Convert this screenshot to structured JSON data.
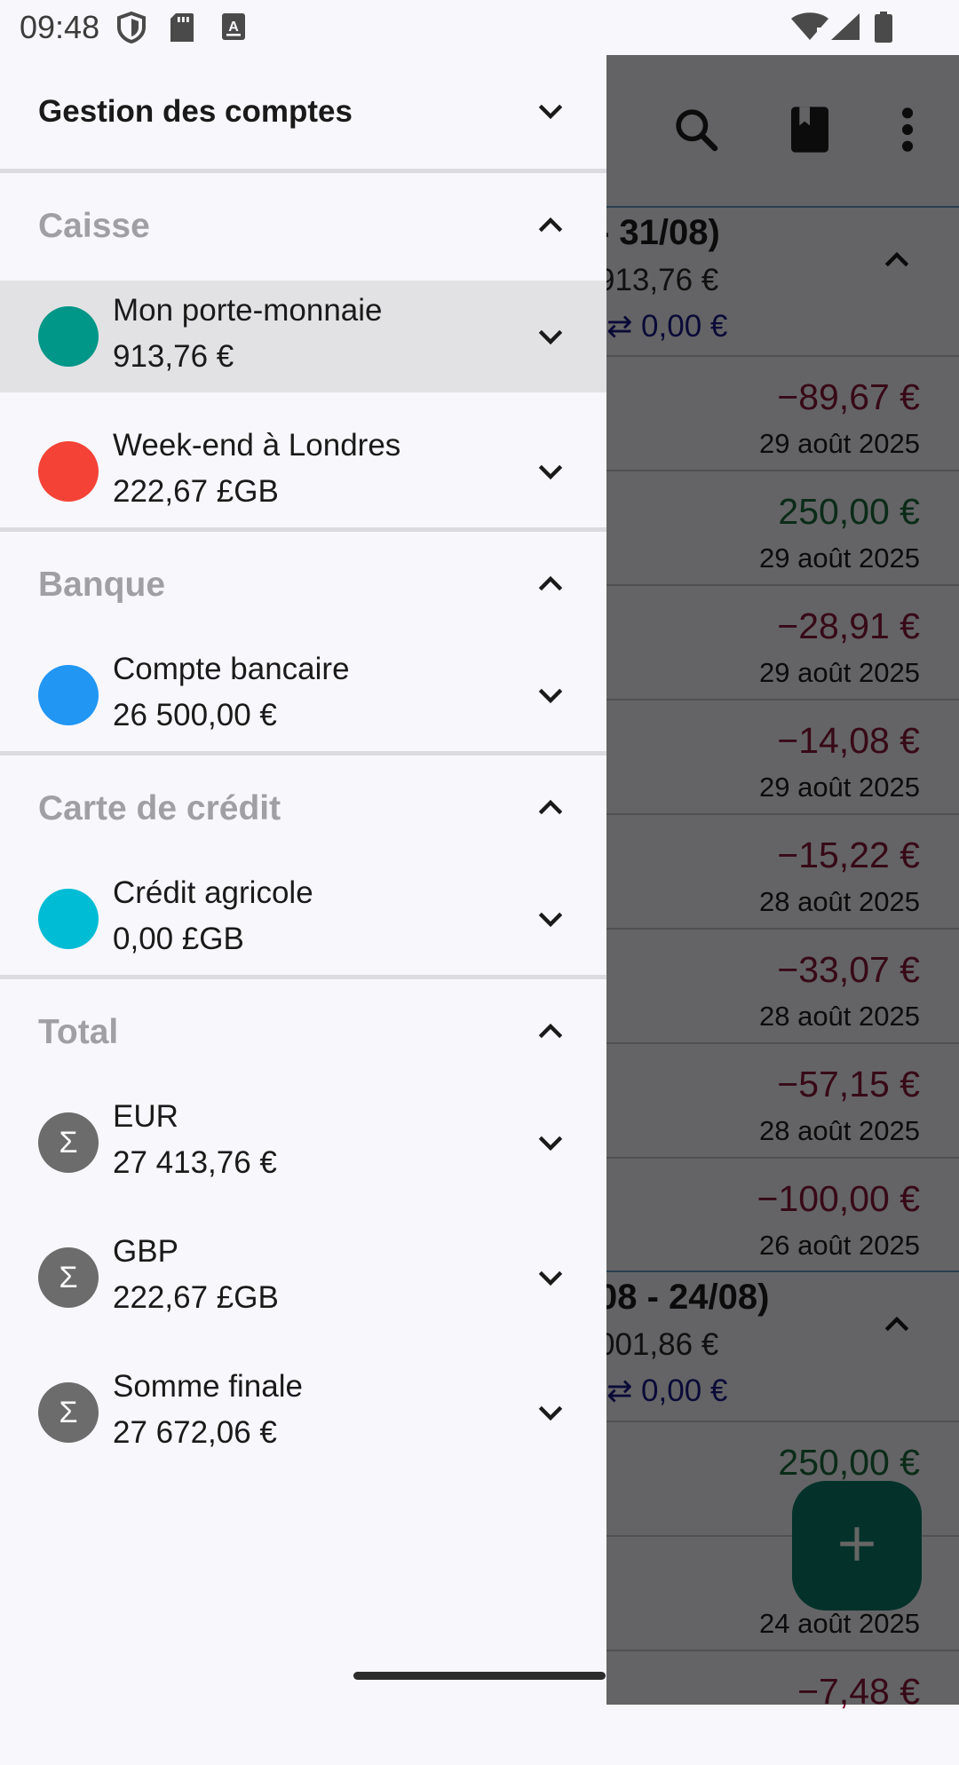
{
  "status_bar": {
    "time": "09:48",
    "left_icons": [
      "shield-icon",
      "sd-card-icon",
      "keyboard-a-icon"
    ],
    "right_icons": [
      "wifi-icon",
      "signal-icon",
      "battery-icon"
    ]
  },
  "drawer": {
    "header_title": "Gestion des comptes",
    "sections": [
      {
        "title": "Caisse",
        "accounts": [
          {
            "name": "Mon porte-monnaie",
            "balance": "913,76 €",
            "color": "#009688",
            "selected": true
          },
          {
            "name": "Week-end à Londres",
            "balance": "222,67 £GB",
            "color": "#f44336"
          }
        ]
      },
      {
        "title": "Banque",
        "accounts": [
          {
            "name": "Compte bancaire",
            "balance": "26 500,00 €",
            "color": "#2196f3"
          }
        ]
      },
      {
        "title": "Carte de crédit",
        "accounts": [
          {
            "name": "Crédit agricole",
            "balance": "0,00 £GB",
            "color": "#00bcd4"
          }
        ]
      },
      {
        "title": "Total",
        "accounts": [
          {
            "name": "EUR",
            "balance": "27 413,76 €",
            "symbol": "Σ"
          },
          {
            "name": "GBP",
            "balance": "222,67 £GB",
            "symbol": "Σ"
          },
          {
            "name": "Somme finale",
            "balance": "27 672,06 €",
            "symbol": "Σ"
          }
        ]
      }
    ]
  },
  "background_app": {
    "toolbar_icons": [
      "search-icon",
      "book-icon",
      "overflow-menu-icon"
    ],
    "groups": [
      {
        "title": "- 31/08)",
        "subtitle": "913,76 €",
        "transfer": "⇄ 0,00 €"
      },
      {
        "title": "08 - 24/08)",
        "subtitle": "001,86 €",
        "transfer": "⇄ 0,00 €"
      }
    ],
    "transactions": [
      {
        "amount": "−89,67 €",
        "date": "29 août 2025",
        "kind": "neg"
      },
      {
        "amount": "250,00 €",
        "date": "29 août 2025",
        "kind": "pos"
      },
      {
        "amount": "−28,91 €",
        "date": "29 août 2025",
        "kind": "neg"
      },
      {
        "amount": "−14,08 €",
        "date": "29 août 2025",
        "kind": "neg"
      },
      {
        "amount": "−15,22 €",
        "date": "28 août 2025",
        "kind": "neg"
      },
      {
        "amount": "−33,07 €",
        "date": "28 août 2025",
        "kind": "neg"
      },
      {
        "amount": "−57,15 €",
        "date": "28 août 2025",
        "kind": "neg"
      },
      {
        "amount": "−100,00 €",
        "date": "26 août 2025",
        "kind": "neg"
      },
      {
        "amount": "250,00 €",
        "date": "24",
        "kind": "pos"
      },
      {
        "amount": "",
        "date": "24 août 2025",
        "kind": "neg"
      },
      {
        "amount": "−7,48 €",
        "date": "",
        "kind": "neg"
      }
    ],
    "fab_icon": "plus-icon"
  }
}
